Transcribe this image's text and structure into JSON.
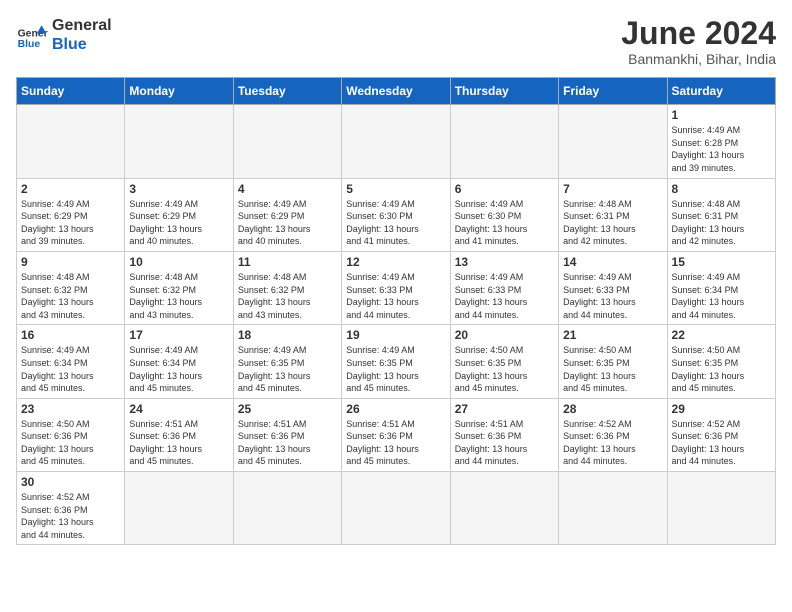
{
  "header": {
    "logo_general": "General",
    "logo_blue": "Blue",
    "month_title": "June 2024",
    "subtitle": "Banmankhi, Bihar, India"
  },
  "weekdays": [
    "Sunday",
    "Monday",
    "Tuesday",
    "Wednesday",
    "Thursday",
    "Friday",
    "Saturday"
  ],
  "weeks": [
    [
      {
        "day": "",
        "info": ""
      },
      {
        "day": "",
        "info": ""
      },
      {
        "day": "",
        "info": ""
      },
      {
        "day": "",
        "info": ""
      },
      {
        "day": "",
        "info": ""
      },
      {
        "day": "",
        "info": ""
      },
      {
        "day": "1",
        "info": "Sunrise: 4:49 AM\nSunset: 6:28 PM\nDaylight: 13 hours\nand 39 minutes."
      }
    ],
    [
      {
        "day": "2",
        "info": "Sunrise: 4:49 AM\nSunset: 6:29 PM\nDaylight: 13 hours\nand 39 minutes."
      },
      {
        "day": "3",
        "info": "Sunrise: 4:49 AM\nSunset: 6:29 PM\nDaylight: 13 hours\nand 40 minutes."
      },
      {
        "day": "4",
        "info": "Sunrise: 4:49 AM\nSunset: 6:29 PM\nDaylight: 13 hours\nand 40 minutes."
      },
      {
        "day": "5",
        "info": "Sunrise: 4:49 AM\nSunset: 6:30 PM\nDaylight: 13 hours\nand 41 minutes."
      },
      {
        "day": "6",
        "info": "Sunrise: 4:49 AM\nSunset: 6:30 PM\nDaylight: 13 hours\nand 41 minutes."
      },
      {
        "day": "7",
        "info": "Sunrise: 4:48 AM\nSunset: 6:31 PM\nDaylight: 13 hours\nand 42 minutes."
      },
      {
        "day": "8",
        "info": "Sunrise: 4:48 AM\nSunset: 6:31 PM\nDaylight: 13 hours\nand 42 minutes."
      }
    ],
    [
      {
        "day": "9",
        "info": "Sunrise: 4:48 AM\nSunset: 6:32 PM\nDaylight: 13 hours\nand 43 minutes."
      },
      {
        "day": "10",
        "info": "Sunrise: 4:48 AM\nSunset: 6:32 PM\nDaylight: 13 hours\nand 43 minutes."
      },
      {
        "day": "11",
        "info": "Sunrise: 4:48 AM\nSunset: 6:32 PM\nDaylight: 13 hours\nand 43 minutes."
      },
      {
        "day": "12",
        "info": "Sunrise: 4:49 AM\nSunset: 6:33 PM\nDaylight: 13 hours\nand 44 minutes."
      },
      {
        "day": "13",
        "info": "Sunrise: 4:49 AM\nSunset: 6:33 PM\nDaylight: 13 hours\nand 44 minutes."
      },
      {
        "day": "14",
        "info": "Sunrise: 4:49 AM\nSunset: 6:33 PM\nDaylight: 13 hours\nand 44 minutes."
      },
      {
        "day": "15",
        "info": "Sunrise: 4:49 AM\nSunset: 6:34 PM\nDaylight: 13 hours\nand 44 minutes."
      }
    ],
    [
      {
        "day": "16",
        "info": "Sunrise: 4:49 AM\nSunset: 6:34 PM\nDaylight: 13 hours\nand 45 minutes."
      },
      {
        "day": "17",
        "info": "Sunrise: 4:49 AM\nSunset: 6:34 PM\nDaylight: 13 hours\nand 45 minutes."
      },
      {
        "day": "18",
        "info": "Sunrise: 4:49 AM\nSunset: 6:35 PM\nDaylight: 13 hours\nand 45 minutes."
      },
      {
        "day": "19",
        "info": "Sunrise: 4:49 AM\nSunset: 6:35 PM\nDaylight: 13 hours\nand 45 minutes."
      },
      {
        "day": "20",
        "info": "Sunrise: 4:50 AM\nSunset: 6:35 PM\nDaylight: 13 hours\nand 45 minutes."
      },
      {
        "day": "21",
        "info": "Sunrise: 4:50 AM\nSunset: 6:35 PM\nDaylight: 13 hours\nand 45 minutes."
      },
      {
        "day": "22",
        "info": "Sunrise: 4:50 AM\nSunset: 6:35 PM\nDaylight: 13 hours\nand 45 minutes."
      }
    ],
    [
      {
        "day": "23",
        "info": "Sunrise: 4:50 AM\nSunset: 6:36 PM\nDaylight: 13 hours\nand 45 minutes."
      },
      {
        "day": "24",
        "info": "Sunrise: 4:51 AM\nSunset: 6:36 PM\nDaylight: 13 hours\nand 45 minutes."
      },
      {
        "day": "25",
        "info": "Sunrise: 4:51 AM\nSunset: 6:36 PM\nDaylight: 13 hours\nand 45 minutes."
      },
      {
        "day": "26",
        "info": "Sunrise: 4:51 AM\nSunset: 6:36 PM\nDaylight: 13 hours\nand 45 minutes."
      },
      {
        "day": "27",
        "info": "Sunrise: 4:51 AM\nSunset: 6:36 PM\nDaylight: 13 hours\nand 44 minutes."
      },
      {
        "day": "28",
        "info": "Sunrise: 4:52 AM\nSunset: 6:36 PM\nDaylight: 13 hours\nand 44 minutes."
      },
      {
        "day": "29",
        "info": "Sunrise: 4:52 AM\nSunset: 6:36 PM\nDaylight: 13 hours\nand 44 minutes."
      }
    ],
    [
      {
        "day": "30",
        "info": "Sunrise: 4:52 AM\nSunset: 6:36 PM\nDaylight: 13 hours\nand 44 minutes."
      },
      {
        "day": "",
        "info": ""
      },
      {
        "day": "",
        "info": ""
      },
      {
        "day": "",
        "info": ""
      },
      {
        "day": "",
        "info": ""
      },
      {
        "day": "",
        "info": ""
      },
      {
        "day": "",
        "info": ""
      }
    ]
  ]
}
